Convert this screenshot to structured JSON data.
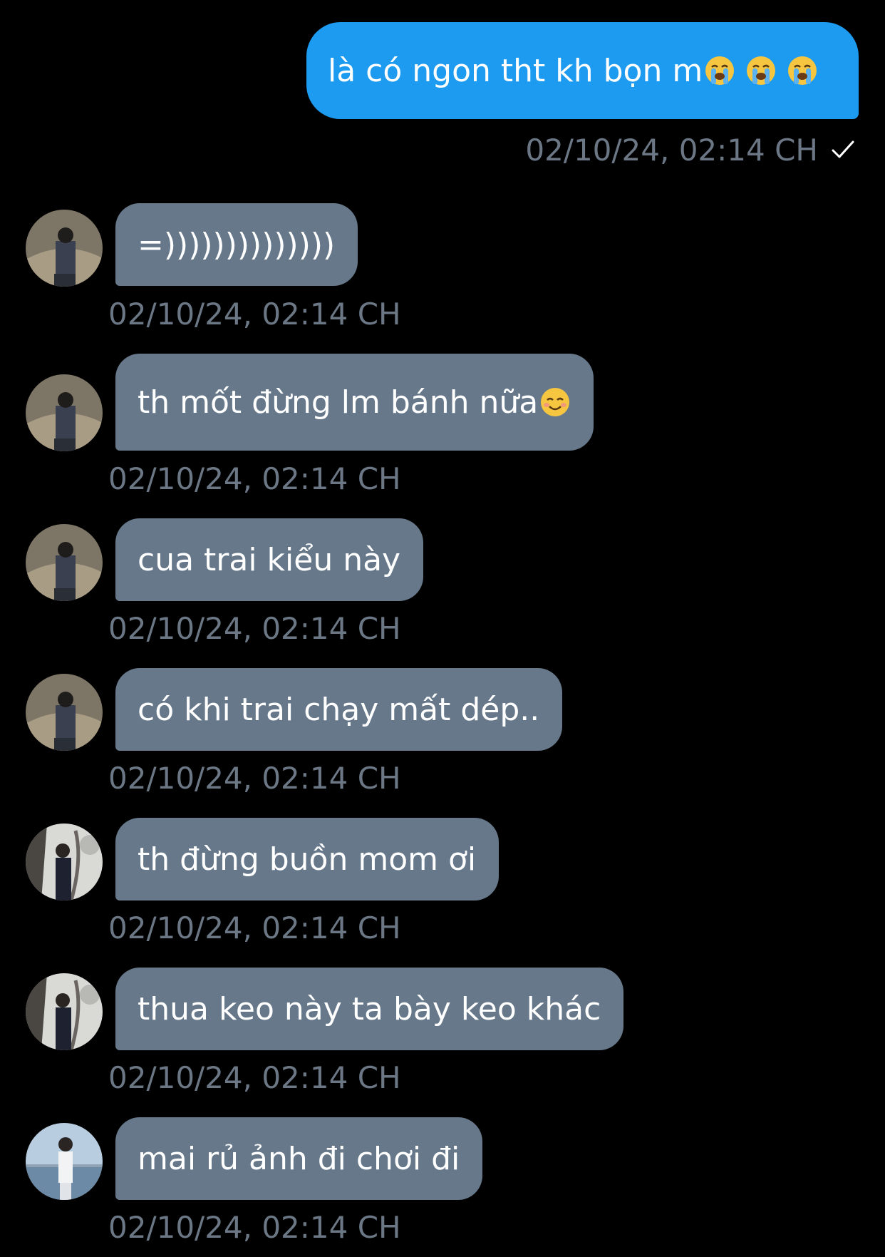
{
  "outgoing": {
    "text": "là có ngon tht kh bọn m",
    "emojis": [
      "loudly-crying-face",
      "loudly-crying-face",
      "loudly-crying-face"
    ],
    "timestamp": "02/10/24, 02:14 CH",
    "status": "sent-check"
  },
  "incoming": [
    {
      "text": "=))))))))))))))",
      "timestamp": "02/10/24, 02:14 CH",
      "avatar": "avatar-person-a"
    },
    {
      "text": "th mốt đừng lm bánh nữa",
      "emoji": "smiling-face",
      "timestamp": "02/10/24, 02:14 CH",
      "avatar": "avatar-person-a"
    },
    {
      "text": "cua trai kiểu này",
      "timestamp": "02/10/24, 02:14 CH",
      "avatar": "avatar-person-a"
    },
    {
      "text": "có khi trai chạy mất dép..",
      "timestamp": "02/10/24, 02:14 CH",
      "avatar": "avatar-person-a"
    },
    {
      "text": "th đừng buồn mom ơi",
      "timestamp": "02/10/24, 02:14 CH",
      "avatar": "avatar-person-b"
    },
    {
      "text": "thua keo này ta bày keo khác",
      "timestamp": "02/10/24, 02:14 CH",
      "avatar": "avatar-person-b"
    },
    {
      "text": "mai rủ ảnh đi chơi đi",
      "timestamp": "02/10/24, 02:14 CH",
      "avatar": "avatar-person-c"
    }
  ],
  "colors": {
    "background": "#000000",
    "outgoing_bubble": "#1d9bf0",
    "incoming_bubble": "#66788a",
    "timestamp": "#6b7785",
    "text": "#ffffff"
  }
}
